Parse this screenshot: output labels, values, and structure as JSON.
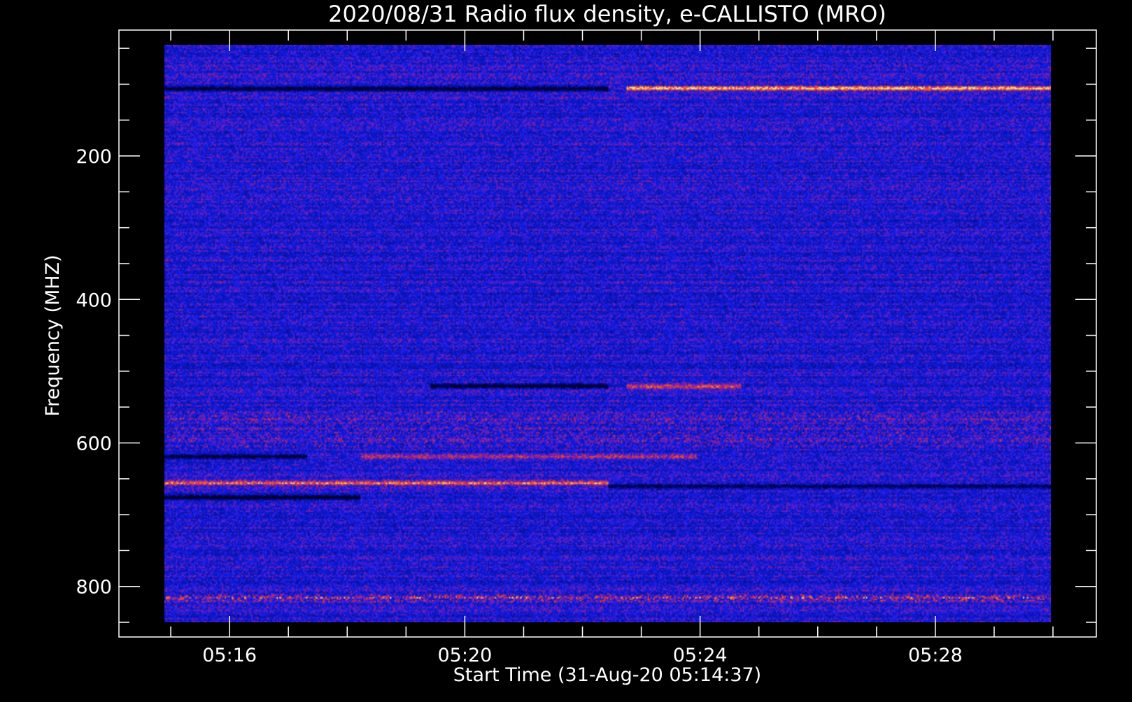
{
  "chart_data": {
    "type": "heatmap",
    "title": "2020/08/31  Radio flux density, e-CALLISTO (MRO)",
    "xlabel": "Start Time (31-Aug-20 05:14:37)",
    "ylabel": "Frequency (MHZ)",
    "x_ticks": [
      {
        "label": "05:16",
        "value": 5.267
      },
      {
        "label": "05:20",
        "value": 5.333
      },
      {
        "label": "05:24",
        "value": 5.4
      },
      {
        "label": "05:28",
        "value": 5.467
      }
    ],
    "y_ticks": [
      {
        "label": "200",
        "value": 200
      },
      {
        "label": "400",
        "value": 400
      },
      {
        "label": "600",
        "value": 600
      },
      {
        "label": "800",
        "value": 800
      }
    ],
    "xlim_label": [
      "05:14:37",
      "05:29:40"
    ],
    "ylim": [
      850,
      45
    ],
    "data_range_y": [
      45,
      850
    ],
    "colormap": [
      "#000010",
      "#1a00ff",
      "#3a2cff",
      "#8a1a9a",
      "#e02a20",
      "#ff8a30",
      "#ffe060"
    ],
    "background_color": "#1e1ef0",
    "features": [
      {
        "name": "dark band 105 MHz pre-event",
        "freq": 105,
        "t_start": 0.0,
        "t_end": 0.5,
        "level": -1.0
      },
      {
        "name": "bright band 105 MHz post-event",
        "freq": 105,
        "t_start": 0.52,
        "t_end": 1.0,
        "level": 1.0
      },
      {
        "name": "dark band 520 MHz pre-event",
        "freq": 520,
        "t_start": 0.3,
        "t_end": 0.5,
        "level": -0.9
      },
      {
        "name": "bright band 520 MHz post-event",
        "freq": 520,
        "t_start": 0.52,
        "t_end": 0.65,
        "level": 0.8
      },
      {
        "name": "dark band 618 MHz",
        "freq": 618,
        "t_start": 0.0,
        "t_end": 0.16,
        "level": -0.9
      },
      {
        "name": "bright band 618 MHz",
        "freq": 618,
        "t_start": 0.22,
        "t_end": 0.6,
        "level": 0.5
      },
      {
        "name": "bright band 655 MHz",
        "freq": 655,
        "t_start": 0.0,
        "t_end": 0.5,
        "level": 0.8
      },
      {
        "name": "dark band 660 MHz",
        "freq": 660,
        "t_start": 0.5,
        "t_end": 1.0,
        "level": -0.8
      },
      {
        "name": "dark band 675 MHz",
        "freq": 675,
        "t_start": 0.0,
        "t_end": 0.22,
        "level": -1.0
      },
      {
        "name": "speckled band 815 MHz",
        "freq": 815,
        "t_start": 0.0,
        "t_end": 1.0,
        "level": 0.5
      }
    ],
    "grid": false,
    "legend": "none"
  }
}
